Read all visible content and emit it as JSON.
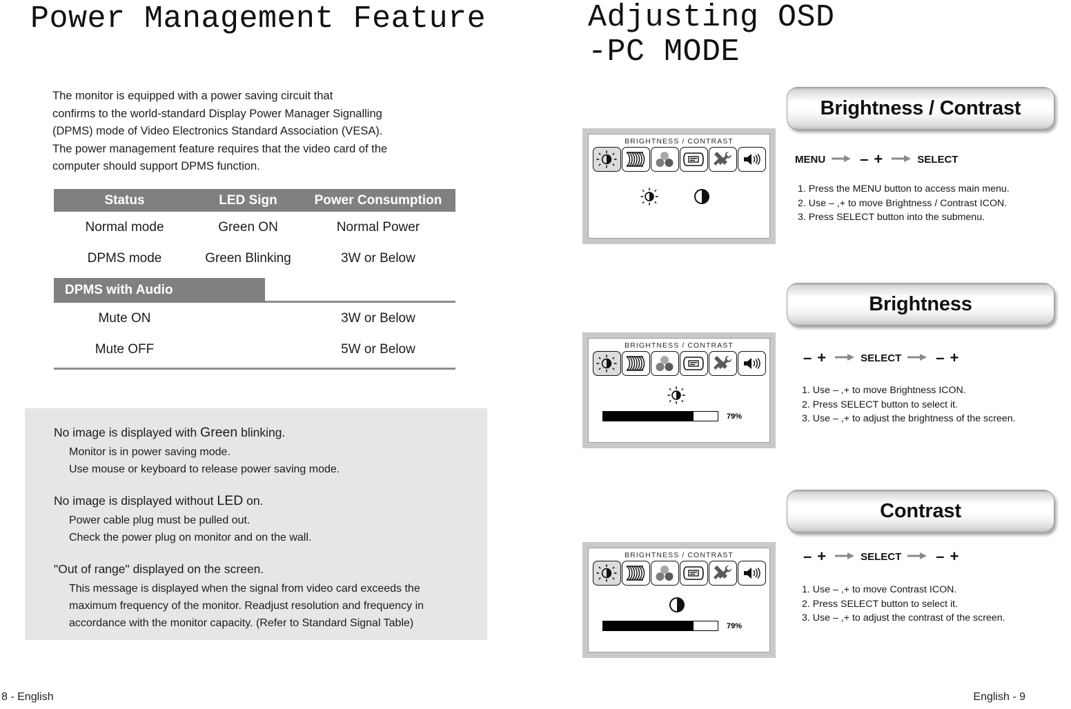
{
  "left": {
    "title": "Power Management Feature",
    "intro_lines": [
      "The monitor is equipped with a power saving circuit that",
      "confirms to the world-standard Display Power Manager Signalling",
      "(DPMS) mode of Video Electronics Standard Association (VESA).",
      "The power management feature requires that the video card of the",
      "computer should support DPMS function."
    ],
    "table": {
      "headers": [
        "Status",
        "LED Sign",
        "Power Consumption"
      ],
      "rows": [
        [
          "Normal mode",
          "Green ON",
          "Normal Power"
        ],
        [
          "DPMS mode",
          "Green Blinking",
          "3W or Below"
        ]
      ],
      "audio_section_label": "DPMS with Audio",
      "audio_rows": [
        [
          "Mute ON",
          "",
          "3W or Below"
        ],
        [
          "Mute OFF",
          "",
          "5W or Below"
        ]
      ]
    },
    "info_panel": {
      "blocks": [
        {
          "head_pre": "No image is displayed with ",
          "head_em": "Green",
          "head_post": " blinking.",
          "subs": [
            "Monitor is in power saving mode.",
            "Use mouse or keyboard to release power saving mode."
          ]
        },
        {
          "head_pre": "No image is displayed without ",
          "head_em": "LED",
          "head_post": " on.",
          "subs": [
            "Power cable plug must be pulled out.",
            "Check the power plug on monitor and on the wall."
          ]
        },
        {
          "head_pre": "\"Out of range\" displayed on the screen.",
          "head_em": "",
          "head_post": "",
          "subs": [
            "This message is displayed when the signal from video card exceeds the maximum frequency of the monitor. Readjust resolution and frequency in accordance with the monitor capacity. (Refer to Standard Signal Table)"
          ]
        }
      ]
    },
    "footer": "8 - English"
  },
  "right": {
    "title": "Adjusting OSD",
    "subtitle": "-PC MODE",
    "osd_screen_title": "BRIGHTNESS / CONTRAST",
    "osd_icons": [
      "brightness-contrast-icon",
      "moire-geometry-icon",
      "color-icon",
      "osd-menu-icon",
      "tools-icon",
      "volume-icon"
    ],
    "sections": [
      {
        "banner": "Brightness / Contrast",
        "banner_first": "Brightness",
        "banner_sep": " / ",
        "banner_second": "Contrast",
        "keyseq": [
          "MENU",
          "arrow",
          "minus",
          "plus",
          "arrow",
          "SELECT"
        ],
        "keyseq_labels": {
          "first": "MENU",
          "last": "SELECT"
        },
        "steps": [
          "1. Press the MENU button to access main menu.",
          "2. Use – ,+ to move Brightness / Contrast ICON.",
          "3. Press SELECT button into the submenu."
        ],
        "osd": {
          "has_bar": false,
          "symbols": [
            "brightness-icon",
            "contrast-icon"
          ]
        }
      },
      {
        "banner": "Brightness",
        "banner_first": "Brightness",
        "banner_sep": "",
        "banner_second": "",
        "keyseq_labels": {
          "first": "",
          "last": "SELECT"
        },
        "steps": [
          "1. Use – ,+ to move Brightness ICON.",
          "2. Press SELECT button to select it.",
          "3. Use – ,+ to adjust the brightness of the screen."
        ],
        "osd": {
          "has_bar": true,
          "percent": "79%",
          "percent_value": 79,
          "symbols": [
            "brightness-icon"
          ]
        }
      },
      {
        "banner": "Contrast",
        "banner_first": "Contrast",
        "banner_sep": "",
        "banner_second": "",
        "keyseq_labels": {
          "first": "",
          "last": "SELECT"
        },
        "steps": [
          "1. Use – ,+ to move Contrast ICON.",
          "2. Press SELECT button to select it.",
          "3. Use – ,+ to adjust the contrast of the screen."
        ],
        "osd": {
          "has_bar": true,
          "percent": "79%",
          "percent_value": 79,
          "symbols": [
            "contrast-icon"
          ]
        }
      }
    ],
    "select_label": "SELECT",
    "menu_label": "MENU",
    "minus_glyph": "–",
    "plus_glyph": "+",
    "footer": "English - 9"
  },
  "colors": {
    "table_header_bg": "#808080",
    "panel_bg": "#e6e6e6",
    "osd_frame": "#c9c9c9",
    "arrow_gray": "#8a8a8a",
    "rule_gray": "#8c8c8c"
  }
}
